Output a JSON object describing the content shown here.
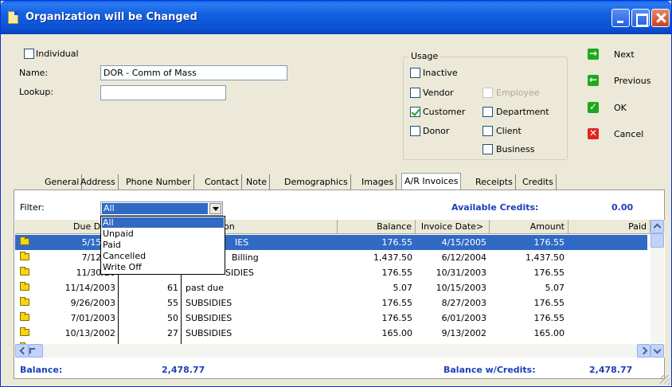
{
  "window": {
    "title": "Organization will be Changed"
  },
  "form": {
    "individual_label": "Individual",
    "name_label": "Name:",
    "name_value": "DOR - Comm of Mass",
    "lookup_label": "Lookup:",
    "lookup_value": ""
  },
  "usage": {
    "label": "Usage",
    "items": [
      {
        "label": "Inactive",
        "checked": false,
        "disabled": false
      },
      {
        "label": "Vendor",
        "checked": false,
        "disabled": false
      },
      {
        "label": "Employee",
        "checked": false,
        "disabled": true
      },
      {
        "label": "Customer",
        "checked": true,
        "disabled": false
      },
      {
        "label": "Department",
        "checked": false,
        "disabled": false
      },
      {
        "label": "Donor",
        "checked": false,
        "disabled": false
      },
      {
        "label": "Client",
        "checked": false,
        "disabled": false
      },
      {
        "label": "Business",
        "checked": false,
        "disabled": false
      }
    ]
  },
  "actions": {
    "next": "Next",
    "previous": "Previous",
    "ok": "OK",
    "cancel": "Cancel"
  },
  "tabs": [
    "General",
    "Address",
    "Phone Number",
    "Contact",
    "Note",
    "Demographics",
    "Images",
    "A/R Invoices",
    "Receipts",
    "Credits"
  ],
  "active_tab": "A/R Invoices",
  "filter": {
    "label": "Filter:",
    "value": "All",
    "options": [
      "All",
      "Unpaid",
      "Paid",
      "Cancelled",
      "Write Off"
    ]
  },
  "available_credits": {
    "label": "Available Credits:",
    "value": "0.00"
  },
  "table": {
    "headers": [
      "Due Date",
      "",
      "Description",
      "Balance",
      "Invoice Date>",
      "Amount",
      "Paid"
    ],
    "header_desc_visible": "on",
    "rows": [
      {
        "due": "5/15/20",
        "num": "",
        "desc": "IES",
        "balance": "176.55",
        "invoice_date": "4/15/2005",
        "amount": "176.55"
      },
      {
        "due": "7/12/20",
        "num": "",
        "desc": "Billing",
        "balance": "1,437.50",
        "invoice_date": "6/12/2004",
        "amount": "1,437.50"
      },
      {
        "due": "11/30/20",
        "num": "",
        "desc": "SIDIES",
        "balance": "176.55",
        "invoice_date": "10/31/2003",
        "amount": "176.55"
      },
      {
        "due": "11/14/2003",
        "num": "61",
        "desc": "past due",
        "balance": "5.07",
        "invoice_date": "10/15/2003",
        "amount": "5.07"
      },
      {
        "due": "9/26/2003",
        "num": "55",
        "desc": "SUBSIDIES",
        "balance": "176.55",
        "invoice_date": "8/27/2003",
        "amount": "176.55"
      },
      {
        "due": "7/01/2003",
        "num": "50",
        "desc": "SUBSIDIES",
        "balance": "176.55",
        "invoice_date": "6/01/2003",
        "amount": "176.55"
      },
      {
        "due": "10/13/2002",
        "num": "27",
        "desc": "SUBSIDIES",
        "balance": "165.00",
        "invoice_date": "9/13/2002",
        "amount": "165.00"
      }
    ]
  },
  "footer": {
    "balance_label": "Balance:",
    "balance_value": "2,478.77",
    "balance_credits_label": "Balance w/Credits:",
    "balance_credits_value": "2,478.77"
  },
  "colors": {
    "titlebar": "#0a50d2",
    "selection": "#316ac5",
    "footer_text": "#1c3fb8",
    "face": "#ece9d8"
  }
}
